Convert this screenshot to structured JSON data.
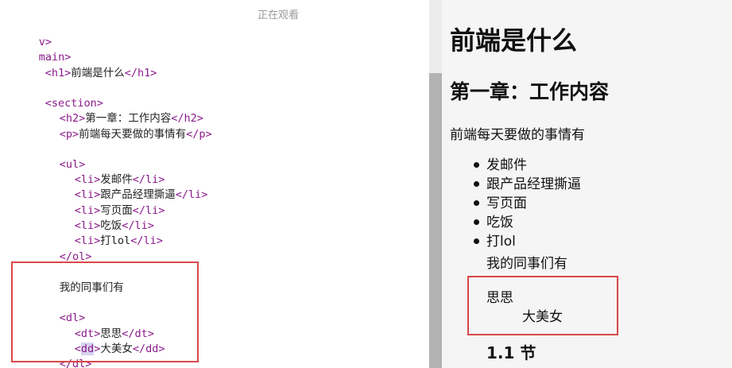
{
  "overlay": {
    "viewing_label": "正在观看"
  },
  "code": {
    "l1": {
      "tag_open": "v>"
    },
    "l2": {
      "tag_open": "main>"
    },
    "l3": {
      "tag_open": "<h1>",
      "text": "前端是什么",
      "tag_close": "</h1>"
    },
    "l4": {
      "tag_open": "<section>"
    },
    "l5": {
      "tag_open": "<h2>",
      "text": "第一章：工作内容",
      "tag_close": "</h2>"
    },
    "l6": {
      "tag_open": "<p>",
      "text": "前端每天要做的事情有",
      "tag_close": "</p>"
    },
    "l7": {
      "tag_open": "<ul>"
    },
    "l8": {
      "tag_open": "<li>",
      "text": "发邮件",
      "tag_close": "</li>"
    },
    "l9": {
      "tag_open": "<li>",
      "text": "跟产品经理撕逼",
      "tag_close": "</li>"
    },
    "l10": {
      "tag_open": "<li>",
      "text": "写页面",
      "tag_close": "</li>"
    },
    "l11": {
      "tag_open": "<li>",
      "text": "吃饭",
      "tag_close": "</li>"
    },
    "l12": {
      "tag_open": "<li>",
      "text": "打lol",
      "tag_close": "</li>"
    },
    "l13": {
      "tag_open": "</ol>"
    },
    "l14": {
      "text": "我的同事们有"
    },
    "l15": {
      "tag_open": "<dl>"
    },
    "l16": {
      "tag_open": "<dt>",
      "text": "思思",
      "tag_close": "</dt>"
    },
    "l17": {
      "tag_lt": "<",
      "tag_name": "dd",
      "tag_gt": ">",
      "text": "大美女",
      "tag_close": "</dd>"
    },
    "l18": {
      "tag_open": "</dl>"
    }
  },
  "preview": {
    "h1": "前端是什么",
    "h2": "第一章：工作内容",
    "p": "前端每天要做的事情有",
    "list": [
      "发邮件",
      "跟产品经理撕逼",
      "写页面",
      "吃饭",
      "打lol"
    ],
    "colleagues": "我的同事们有",
    "dt": "思思",
    "dd": "大美女",
    "h3": "1.1 节"
  },
  "colors": {
    "highlight_box": "#d94848",
    "tag": "#8b1a8b",
    "selection": "#d6d3ee"
  }
}
